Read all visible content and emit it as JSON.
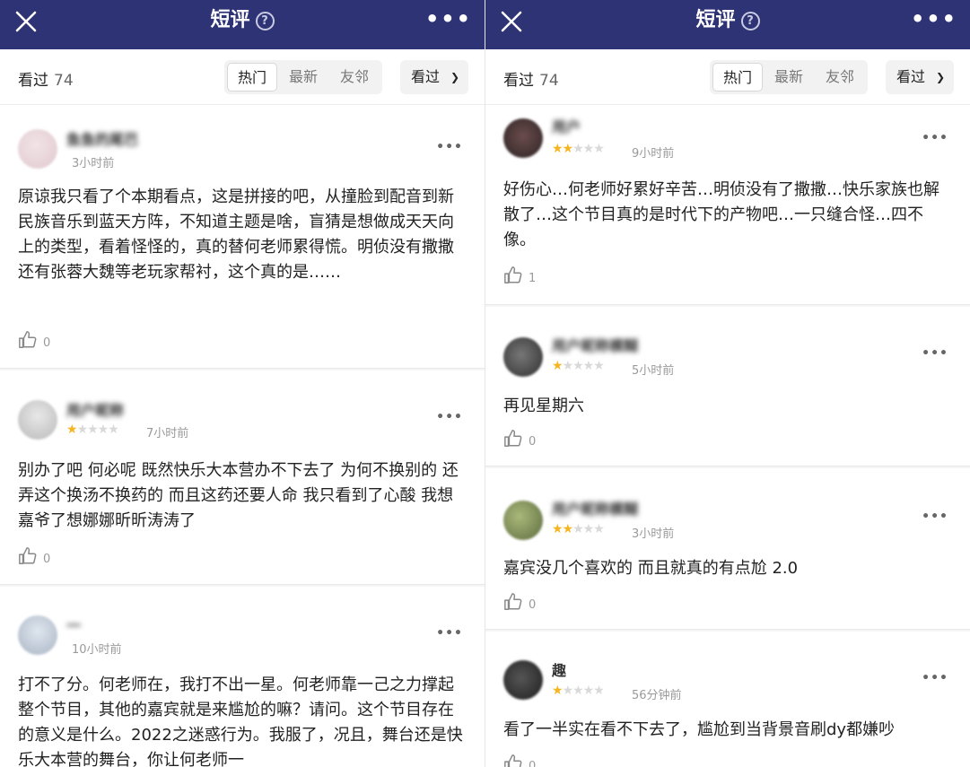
{
  "header": {
    "title": "短评",
    "help_glyph": "?",
    "more_glyph": "•••"
  },
  "filter": {
    "seen_label": "看过",
    "seen_count": "74",
    "tabs": [
      "热门",
      "最新",
      "友邻"
    ],
    "active_tab": "热门",
    "dropdown_label": "看过"
  },
  "colors": {
    "header_bg": "#2d3375",
    "star_on": "#f6b41e",
    "star_off": "#d9d9d9"
  },
  "left_reviews": [
    {
      "user": "鱼鱼的尾巴",
      "rating": 0,
      "time": "3小时前",
      "text": "原谅我只看了个本期看点，这是拼接的吧，从撞脸到配音到新民族音乐到蓝天方阵，不知道主题是啥，盲猜是想做成天天向上的类型，看着怪怪的，真的替何老师累得慌。明侦没有撒撒还有张蓉大魏等老玩家帮衬，这个真的是……",
      "likes": "0"
    },
    {
      "user": "用户昵称",
      "rating": 1,
      "time": "7小时前",
      "text": " 别办了吧 何必呢 既然快乐大本营办不下去了 为何不换别的 还弄这个换汤不换药的 而且这药还要人命 我只看到了心酸 我想嘉爷了想娜娜昕昕涛涛了",
      "likes": "0"
    },
    {
      "user": "一",
      "rating": 0,
      "time": "10小时前",
      "text": "打不了分。何老师在，我打不出一星。何老师靠一己之力撑起整个节目，其他的嘉宾就是来尴尬的嘛？请问。这个节目存在的意义是什么。2022之迷惑行为。我服了，况且，舞台还是快乐大本营的舞台，你让何老师一",
      "likes": ""
    }
  ],
  "right_reviews": [
    {
      "user": "用户",
      "rating": 2,
      "time": "9小时前",
      "text": "好伤心…何老师好累好辛苦…明侦没有了撒撒…快乐家族也解散了…这个节目真的是时代下的产物吧…一只缝合怪…四不像。",
      "likes": "1"
    },
    {
      "user": "用户昵称模糊",
      "rating": 1,
      "time": "5小时前",
      "text": "再见星期六",
      "likes": "0"
    },
    {
      "user": "用户昵称模糊",
      "rating": 2,
      "time": "3小时前",
      "text": "嘉宾没几个喜欢的 而且就真的有点尬 2.0",
      "likes": "0"
    },
    {
      "user": "趣",
      "rating": 1,
      "time": "56分钟前",
      "text": "看了一半实在看不下去了，尴尬到当背景音刷dy都嫌吵",
      "likes": "0"
    }
  ]
}
